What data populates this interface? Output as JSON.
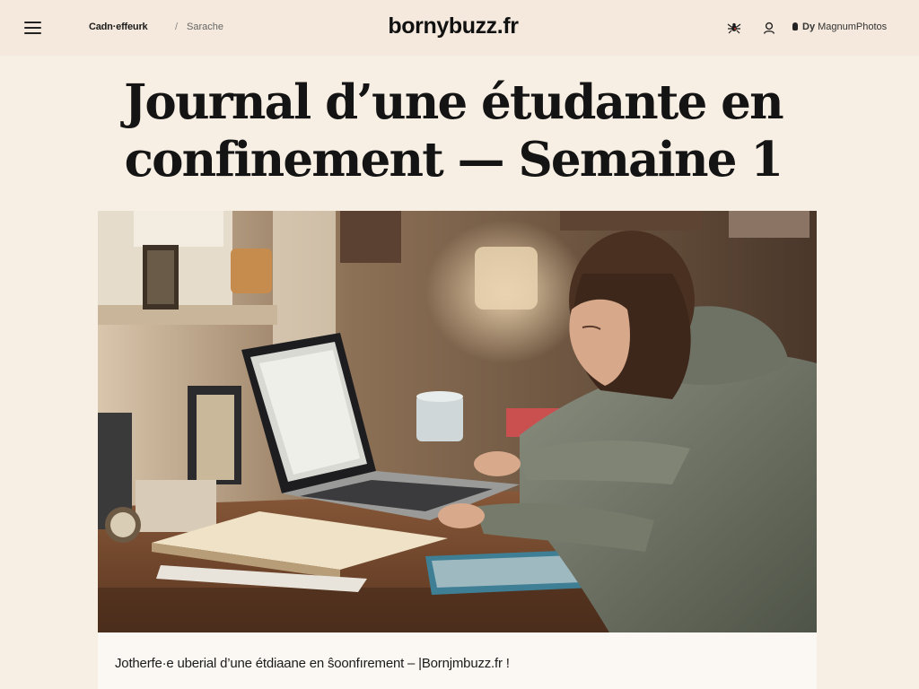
{
  "header": {
    "brand": "bornybuzz.fr",
    "breadcrumb": {
      "primary": "Cadn·effeurk",
      "separator": "/",
      "secondary": "Sarache"
    },
    "credit": {
      "prefix": "Dy",
      "name": "MagnumPhotos"
    },
    "icons": {
      "menu": "hamburger-menu-icon",
      "action_left": "spider-icon",
      "action_right": "user-icon",
      "credit": "camera-lock-icon"
    }
  },
  "article": {
    "title": "Journal d’une étudante en confinement — Semaine 1",
    "caption": "Jotherfe·e uberial d’une étdiaane en ŝoonfırement – |Bornjmbuzz.fr !"
  },
  "colors": {
    "page_bg": "#f8efe4",
    "topbar_bg": "#f4e9dc",
    "text": "#111111"
  }
}
